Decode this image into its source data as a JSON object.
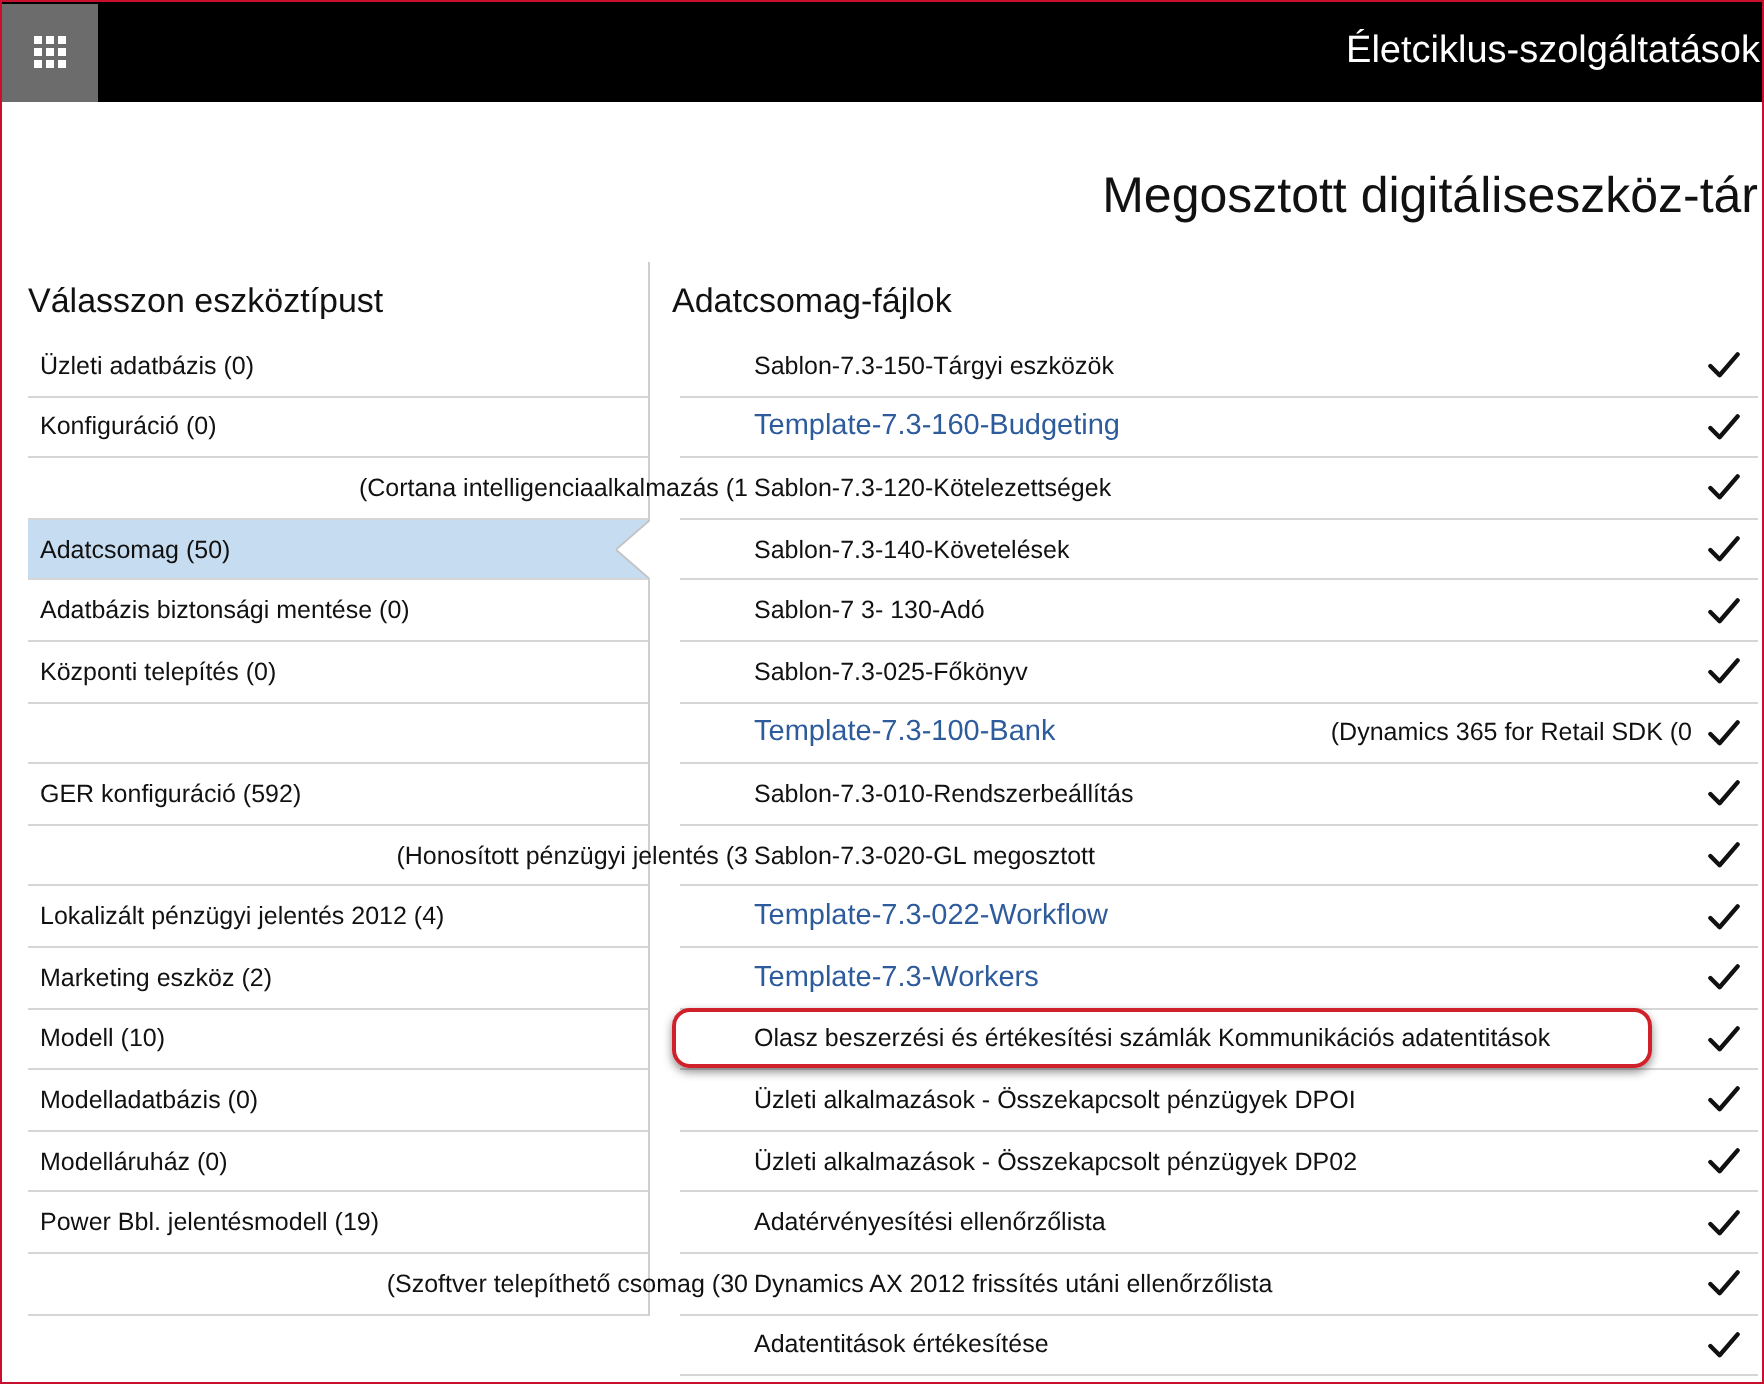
{
  "header": {
    "title": "Életciklus-szolgáltatások"
  },
  "page_title": "Megosztott digitáliseszköz-tár",
  "asset_types": {
    "heading": "Válasszon eszköztípust",
    "items": [
      {
        "label": "Üzleti adatbázis (0)",
        "kind": "item",
        "selected": false
      },
      {
        "label": "Konfiguráció (0)",
        "kind": "item",
        "selected": false
      },
      {
        "label": "(Cortana intelligenciaalkalmazás (1",
        "kind": "spill",
        "selected": false
      },
      {
        "label": "Adatcsomag (50)",
        "kind": "item",
        "selected": true
      },
      {
        "label": "Adatbázis biztonsági mentése (0)",
        "kind": "item",
        "selected": false
      },
      {
        "label": "Központi telepítés (0)",
        "kind": "item",
        "selected": false
      },
      {
        "label": "(Dynamics 365 for Retail SDK (0",
        "kind": "stray",
        "selected": false
      },
      {
        "label": "GER konfiguráció (592)",
        "kind": "item",
        "selected": false
      },
      {
        "label": "(Honosított pénzügyi jelentés (3",
        "kind": "spill",
        "selected": false
      },
      {
        "label": "Lokalizált pénzügyi jelentés 2012 (4)",
        "kind": "item",
        "selected": false
      },
      {
        "label": "Marketing eszköz (2)",
        "kind": "item",
        "selected": false
      },
      {
        "label": "Modell (10)",
        "kind": "item",
        "selected": false
      },
      {
        "label": "Modelladatbázis (0)",
        "kind": "item",
        "selected": false
      },
      {
        "label": "Modelláruház (0)",
        "kind": "item",
        "selected": false
      },
      {
        "label": "Power Bbl. jelentésmodell (19)",
        "kind": "item",
        "selected": false
      },
      {
        "label": "(Szoftver telepíthető csomag (30",
        "kind": "spill",
        "selected": false
      }
    ]
  },
  "files": {
    "heading": "Adatcsomag-fájlok",
    "items": [
      {
        "name": "Sablon-7.3-150-Tárgyi eszközök",
        "kind": "plain",
        "checked": true,
        "highlighted": false
      },
      {
        "name": "Template-7.3-160-Budgeting",
        "kind": "link",
        "checked": true,
        "highlighted": false
      },
      {
        "name": "Sablon-7.3-120-Kötelezettségek",
        "kind": "plain",
        "checked": true,
        "highlighted": false
      },
      {
        "name": "Sablon-7.3-140-Követelések",
        "kind": "plain",
        "checked": true,
        "highlighted": false
      },
      {
        "name": "Sablon-7 3- 130-Adó",
        "kind": "plain",
        "checked": true,
        "highlighted": false
      },
      {
        "name": "Sablon-7.3-025-Főkönyv",
        "kind": "plain",
        "checked": true,
        "highlighted": false
      },
      {
        "name": "Template-7.3-100-Bank",
        "kind": "link",
        "checked": true,
        "highlighted": false
      },
      {
        "name": "Sablon-7.3-010-Rendszerbeállítás",
        "kind": "plain",
        "checked": true,
        "highlighted": false
      },
      {
        "name": "Sablon-7.3-020-GL megosztott",
        "kind": "plain",
        "checked": true,
        "highlighted": false
      },
      {
        "name": "Template-7.3-022-Workflow",
        "kind": "link",
        "checked": true,
        "highlighted": false
      },
      {
        "name": "Template-7.3-Workers",
        "kind": "link",
        "checked": true,
        "highlighted": false
      },
      {
        "name": "Olasz beszerzési és értékesítési számlák Kommunikációs adatentitások",
        "kind": "plain",
        "checked": true,
        "highlighted": true
      },
      {
        "name": "Üzleti alkalmazások - Összekapcsolt pénzügyek DPOI",
        "kind": "plain",
        "checked": true,
        "highlighted": false
      },
      {
        "name": "Üzleti alkalmazások - Összekapcsolt pénzügyek DP02",
        "kind": "plain",
        "checked": true,
        "highlighted": false
      },
      {
        "name": "Adatérvényesítési ellenőrzőlista",
        "kind": "plain",
        "checked": true,
        "highlighted": false
      },
      {
        "name": "Dynamics AX 2012 frissítés utáni ellenőrzőlista",
        "kind": "plain",
        "checked": true,
        "highlighted": false
      },
      {
        "name": "Adatentitások értékesítése",
        "kind": "plain",
        "checked": true,
        "highlighted": false
      }
    ]
  }
}
